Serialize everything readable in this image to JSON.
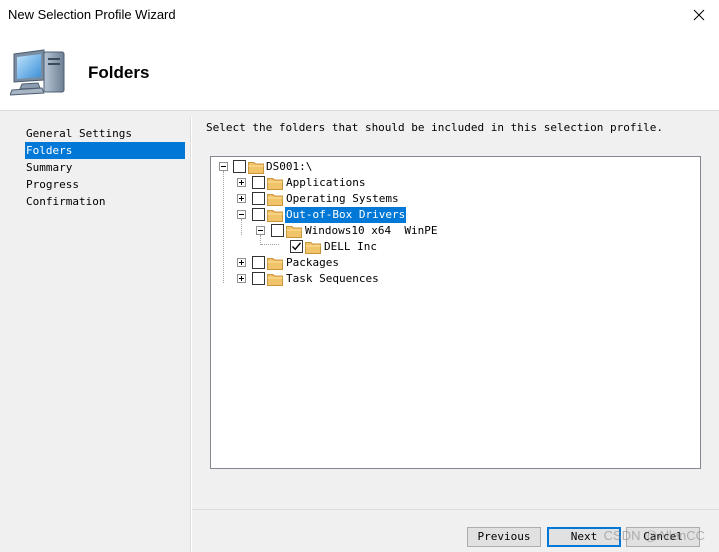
{
  "window": {
    "title": "New Selection Profile Wizard"
  },
  "header": {
    "title": "Folders",
    "icon": "computer-icon"
  },
  "sidebar": {
    "items": [
      {
        "label": "General Settings",
        "active": false
      },
      {
        "label": "Folders",
        "active": true
      },
      {
        "label": "Summary",
        "active": false
      },
      {
        "label": "Progress",
        "active": false
      },
      {
        "label": "Confirmation",
        "active": false
      }
    ]
  },
  "main": {
    "instruction": "Select the folders that should be included in this selection profile.",
    "tree": {
      "root": {
        "label": "DS001:\\",
        "checked": false,
        "expanded": true
      },
      "applications": {
        "label": "Applications",
        "checked": false,
        "expanded": false
      },
      "operating_systems": {
        "label": "Operating Systems",
        "checked": false,
        "expanded": false
      },
      "drivers": {
        "label": "Out-of-Box Drivers",
        "checked": false,
        "expanded": true,
        "selected": true
      },
      "windows10": {
        "label": "Windows10 x64  WinPE",
        "checked": false,
        "expanded": true
      },
      "dell": {
        "label": "DELL Inc",
        "checked": true
      },
      "packages": {
        "label": "Packages",
        "checked": false,
        "expanded": false
      },
      "task_sequences": {
        "label": "Task Sequences",
        "checked": false,
        "expanded": false
      }
    }
  },
  "footer": {
    "previous": "Previous",
    "next": "Next",
    "cancel": "Cancel"
  },
  "watermark": "CSDN @AllenCC",
  "colors": {
    "accent": "#0078d7",
    "panel": "#f0f0f0",
    "folder": "#f2c46a"
  }
}
